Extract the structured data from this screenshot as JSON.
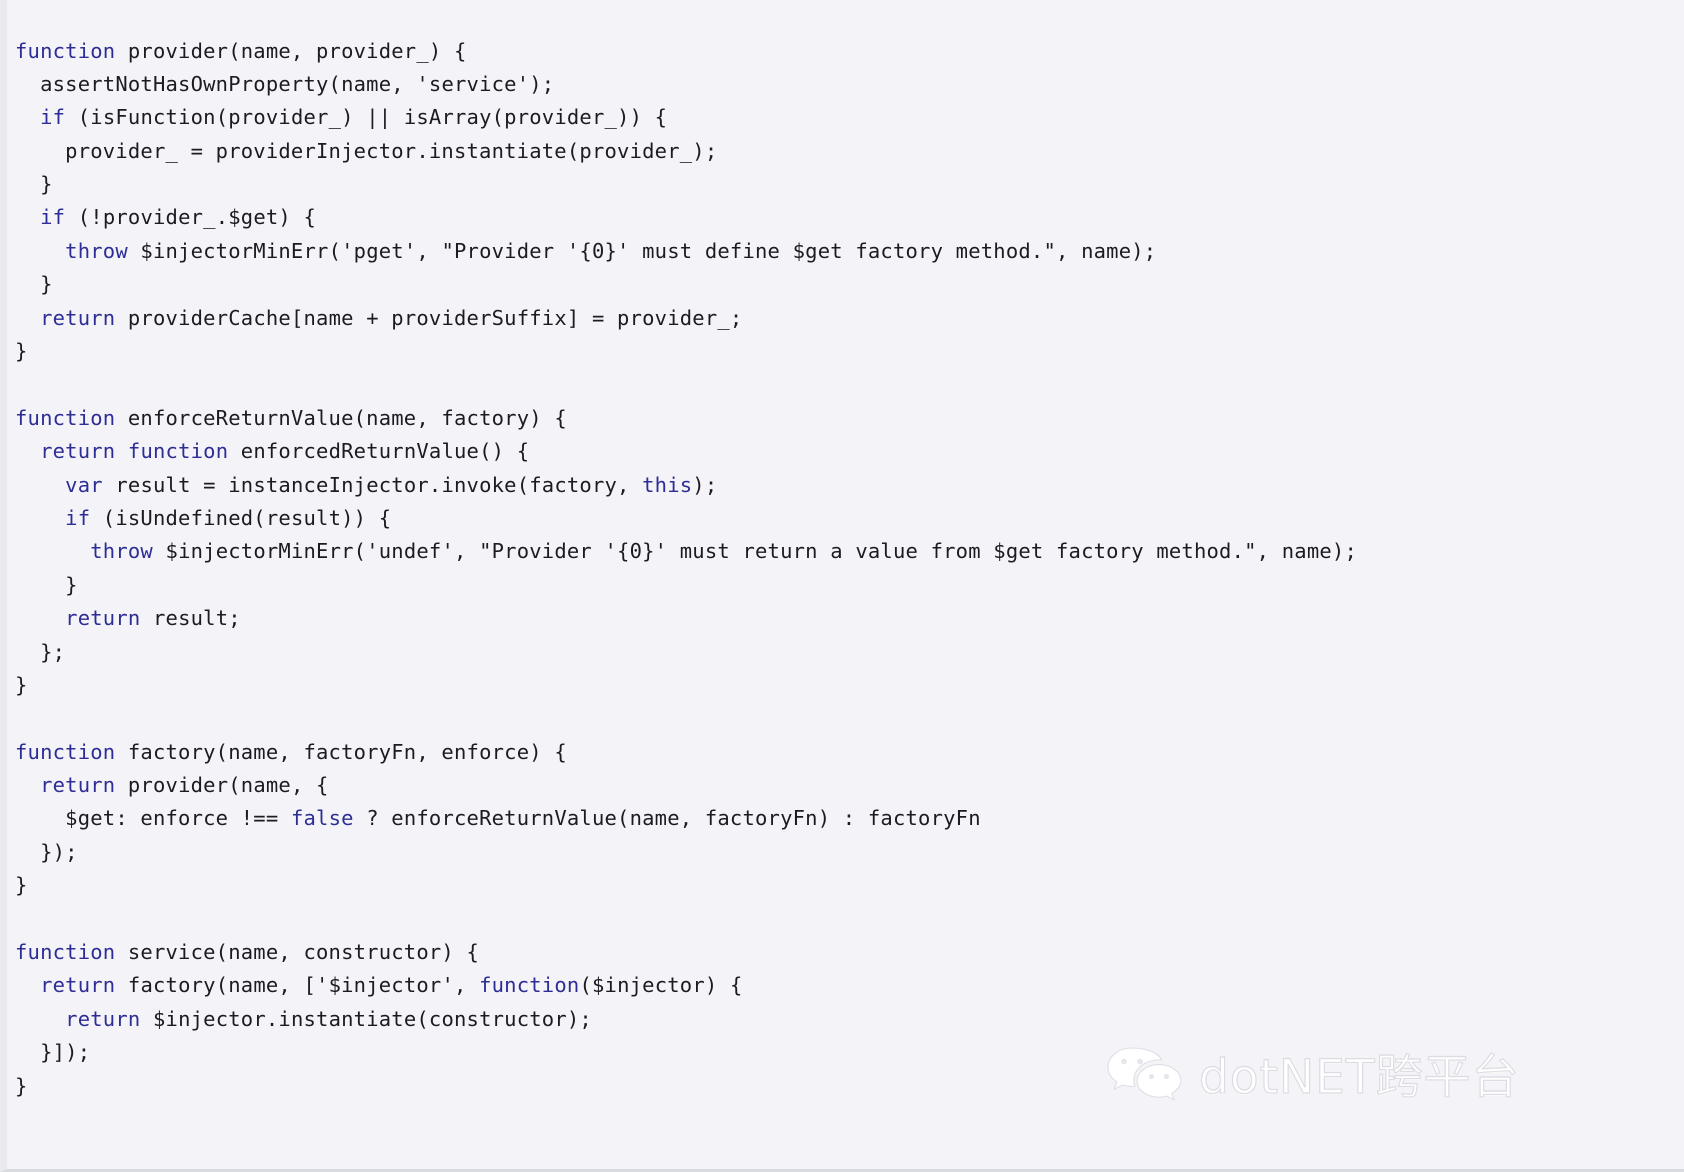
{
  "page": {
    "kind": "source-code-listing",
    "language": "JavaScript",
    "background_color": "#f4f4f8",
    "text_color": "#1c1c20",
    "keyword_color": "#2d2d96"
  },
  "code": {
    "lines": [
      {
        "indent": 0,
        "segments": [
          {
            "t": "function",
            "k": true
          },
          {
            "t": " provider(name, provider_) {",
            "k": false
          }
        ]
      },
      {
        "indent": 1,
        "segments": [
          {
            "t": "assertNotHasOwnProperty(name, 'service');",
            "k": false
          }
        ]
      },
      {
        "indent": 1,
        "segments": [
          {
            "t": "if",
            "k": true
          },
          {
            "t": " (isFunction(provider_) || isArray(provider_)) {",
            "k": false
          }
        ]
      },
      {
        "indent": 2,
        "segments": [
          {
            "t": "provider_ = providerInjector.instantiate(provider_);",
            "k": false
          }
        ]
      },
      {
        "indent": 1,
        "segments": [
          {
            "t": "}",
            "k": false
          }
        ]
      },
      {
        "indent": 1,
        "segments": [
          {
            "t": "if",
            "k": true
          },
          {
            "t": " (!provider_.$get) {",
            "k": false
          }
        ]
      },
      {
        "indent": 2,
        "segments": [
          {
            "t": "throw",
            "k": true
          },
          {
            "t": " $injectorMinErr('pget', \"Provider '{0}' must define $get factory method.\", name);",
            "k": false
          }
        ]
      },
      {
        "indent": 1,
        "segments": [
          {
            "t": "}",
            "k": false
          }
        ]
      },
      {
        "indent": 1,
        "segments": [
          {
            "t": "return",
            "k": true
          },
          {
            "t": " providerCache[name + providerSuffix] = provider_;",
            "k": false
          }
        ]
      },
      {
        "indent": 0,
        "segments": [
          {
            "t": "}",
            "k": false
          }
        ]
      },
      {
        "indent": 0,
        "segments": []
      },
      {
        "indent": 0,
        "segments": [
          {
            "t": "function",
            "k": true
          },
          {
            "t": " enforceReturnValue(name, factory) {",
            "k": false
          }
        ]
      },
      {
        "indent": 1,
        "segments": [
          {
            "t": "return",
            "k": true
          },
          {
            "t": " ",
            "k": false
          },
          {
            "t": "function",
            "k": true
          },
          {
            "t": " enforcedReturnValue() {",
            "k": false
          }
        ]
      },
      {
        "indent": 2,
        "segments": [
          {
            "t": "var",
            "k": true
          },
          {
            "t": " result = instanceInjector.invoke(factory, ",
            "k": false
          },
          {
            "t": "this",
            "k": true
          },
          {
            "t": ");",
            "k": false
          }
        ]
      },
      {
        "indent": 2,
        "segments": [
          {
            "t": "if",
            "k": true
          },
          {
            "t": " (isUndefined(result)) {",
            "k": false
          }
        ]
      },
      {
        "indent": 3,
        "segments": [
          {
            "t": "throw",
            "k": true
          },
          {
            "t": " $injectorMinErr('undef', \"Provider '{0}' must return a value from $get factory method.\", name);",
            "k": false
          }
        ]
      },
      {
        "indent": 2,
        "segments": [
          {
            "t": "}",
            "k": false
          }
        ]
      },
      {
        "indent": 2,
        "segments": [
          {
            "t": "return",
            "k": true
          },
          {
            "t": " result;",
            "k": false
          }
        ]
      },
      {
        "indent": 1,
        "segments": [
          {
            "t": "};",
            "k": false
          }
        ]
      },
      {
        "indent": 0,
        "segments": [
          {
            "t": "}",
            "k": false
          }
        ]
      },
      {
        "indent": 0,
        "segments": []
      },
      {
        "indent": 0,
        "segments": [
          {
            "t": "function",
            "k": true
          },
          {
            "t": " factory(name, factoryFn, enforce) {",
            "k": false
          }
        ]
      },
      {
        "indent": 1,
        "segments": [
          {
            "t": "return",
            "k": true
          },
          {
            "t": " provider(name, {",
            "k": false
          }
        ]
      },
      {
        "indent": 2,
        "segments": [
          {
            "t": "$get: enforce !== ",
            "k": false
          },
          {
            "t": "false",
            "k": true
          },
          {
            "t": " ? enforceReturnValue(name, factoryFn) : factoryFn",
            "k": false
          }
        ]
      },
      {
        "indent": 1,
        "segments": [
          {
            "t": "});",
            "k": false
          }
        ]
      },
      {
        "indent": 0,
        "segments": [
          {
            "t": "}",
            "k": false
          }
        ]
      },
      {
        "indent": 0,
        "segments": []
      },
      {
        "indent": 0,
        "segments": [
          {
            "t": "function",
            "k": true
          },
          {
            "t": " service(name, constructor) {",
            "k": false
          }
        ]
      },
      {
        "indent": 1,
        "segments": [
          {
            "t": "return",
            "k": true
          },
          {
            "t": " factory(name, ['$injector', ",
            "k": false
          },
          {
            "t": "function",
            "k": true
          },
          {
            "t": "($injector) {",
            "k": false
          }
        ]
      },
      {
        "indent": 2,
        "segments": [
          {
            "t": "return",
            "k": true
          },
          {
            "t": " $injector.instantiate(constructor);",
            "k": false
          }
        ]
      },
      {
        "indent": 1,
        "segments": [
          {
            "t": "}]);",
            "k": false
          }
        ]
      },
      {
        "indent": 0,
        "segments": [
          {
            "t": "}",
            "k": false
          }
        ]
      }
    ],
    "plain_text": "function provider(name, provider_) {\n  assertNotHasOwnProperty(name, 'service');\n  if (isFunction(provider_) || isArray(provider_)) {\n    provider_ = providerInjector.instantiate(provider_);\n  }\n  if (!provider_.$get) {\n    throw $injectorMinErr('pget', \"Provider '{0}' must define $get factory method.\", name);\n  }\n  return providerCache[name + providerSuffix] = provider_;\n}\n\nfunction enforceReturnValue(name, factory) {\n  return function enforcedReturnValue() {\n    var result = instanceInjector.invoke(factory, this);\n    if (isUndefined(result)) {\n      throw $injectorMinErr('undef', \"Provider '{0}' must return a value from $get factory method.\", name);\n    }\n    return result;\n  };\n}\n\nfunction factory(name, factoryFn, enforce) {\n  return provider(name, {\n    $get: enforce !== false ? enforceReturnValue(name, factoryFn) : factoryFn\n  });\n}\n\nfunction service(name, constructor) {\n  return factory(name, ['$injector', function($injector) {\n    return $injector.instantiate(constructor);\n  }]);\n}"
  },
  "watermark": {
    "text": "dotNET跨平台",
    "logo_icon": "wechat-icon",
    "color": "#dcdce2"
  }
}
